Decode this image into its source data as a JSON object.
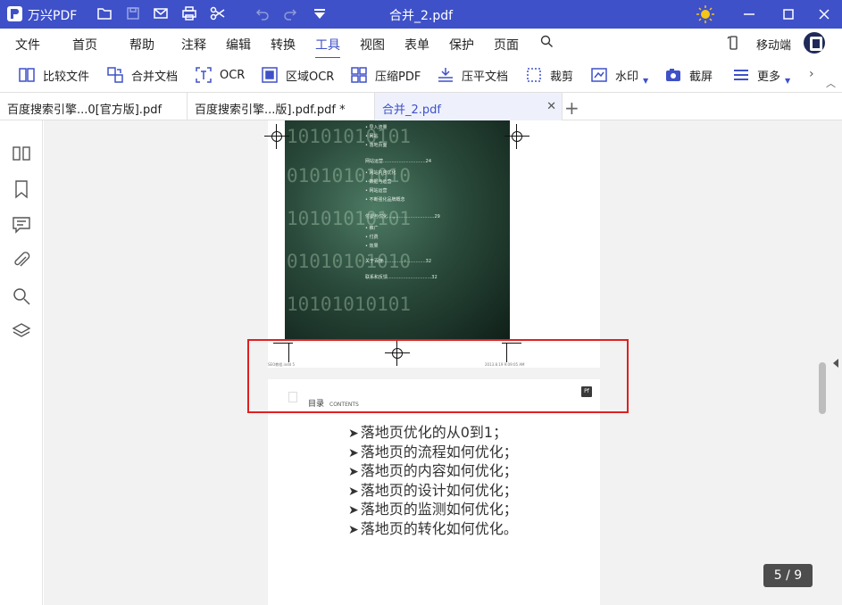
{
  "app": {
    "name": "万兴PDF",
    "doc_title": "合并_2.pdf"
  },
  "menu": {
    "items": [
      "文件",
      "首页",
      "帮助",
      "注释",
      "编辑",
      "转换",
      "工具",
      "视图",
      "表单",
      "保护",
      "页面"
    ],
    "active": "工具",
    "mobile": "移动端"
  },
  "toolbar": {
    "tools": [
      "比较文件",
      "合并文档",
      "OCR",
      "区域OCR",
      "压缩PDF",
      "压平文档",
      "裁剪",
      "水印",
      "截屏",
      "更多"
    ]
  },
  "tabs": [
    {
      "label": "百度搜索引擎...0[官方版].pdf"
    },
    {
      "label": "百度搜索引擎...版].pdf.pdf *"
    },
    {
      "label": "合并_2.pdf"
    }
  ],
  "page": {
    "cover_toc": [
      "• 导入流量",
      "• 网站",
      "• 落地页面",
      "网站运营..............................24",
      "• 网站内容优化",
      "• 数据与运营",
      "• 网站运营",
      "• 不断强化品牌概念",
      "付费与优化.................................29",
      "• 推广",
      "• 付费",
      "• 效果",
      "关于百度..............................32",
      "联系和反馈...............................32"
    ],
    "binary_lines": [
      "10101010101",
      "01010101010",
      "10101010101",
      "01010101010",
      "10101010101",
      "01010101010",
      "10101010101"
    ],
    "footer_left": "SEO教程.indd 5",
    "footer_right": "2013.8.19 9:09:05 AM",
    "contents_cn": "目录",
    "contents_en": "CONTENTS",
    "badge": "Pf",
    "bullets": [
      "落地页优化的从0到1；",
      "落地页的流程如何优化；",
      "落地页的内容如何优化；",
      "落地页的设计如何优化；",
      "落地页的监测如何优化；",
      "落地页的转化如何优化。"
    ]
  },
  "page_indicator": "5 / 9",
  "colors": {
    "accent": "#3f51c8",
    "highlight": "#e02020"
  }
}
